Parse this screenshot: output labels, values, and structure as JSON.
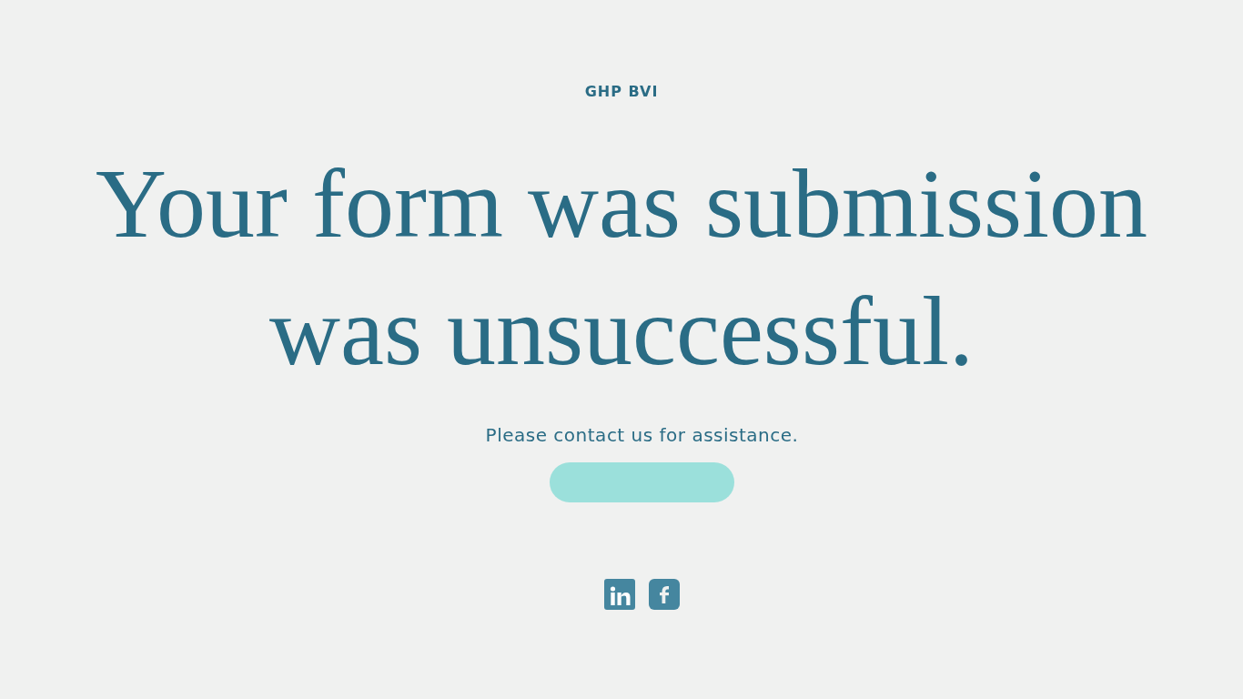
{
  "brand": "GHP BVI",
  "heading": "Your form was submission was unsuccessful.",
  "message": "Please contact us for assistance.",
  "button": {
    "kind": "blank"
  },
  "social": [
    {
      "kind": "linkedin"
    },
    {
      "kind": "facebook"
    }
  ]
}
